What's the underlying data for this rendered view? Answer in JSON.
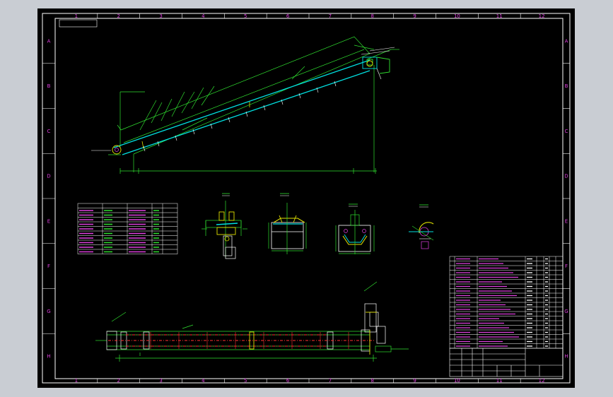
{
  "frame": {
    "zone_columns": [
      "1",
      "2",
      "3",
      "4",
      "5",
      "6",
      "7",
      "8",
      "9",
      "10",
      "11",
      "12"
    ],
    "zone_rows": [
      "A",
      "B",
      "C",
      "D",
      "E",
      "F",
      "G",
      "H"
    ]
  },
  "colors": {
    "background_window": "#c9cdd3",
    "sheet": "#000000",
    "border": "#ffffff",
    "dimension": "#30e030",
    "belt": "#00e0e0",
    "centerline": "#ff3030",
    "text": "#e040e0"
  },
  "views": [
    "inclined-conveyor-side-elevation",
    "drive-pulley-section",
    "carrying-idler-section",
    "return-idler-section",
    "tail-detail",
    "conveyor-plan-view",
    "parameter-table",
    "parts-list",
    "title-block"
  ]
}
